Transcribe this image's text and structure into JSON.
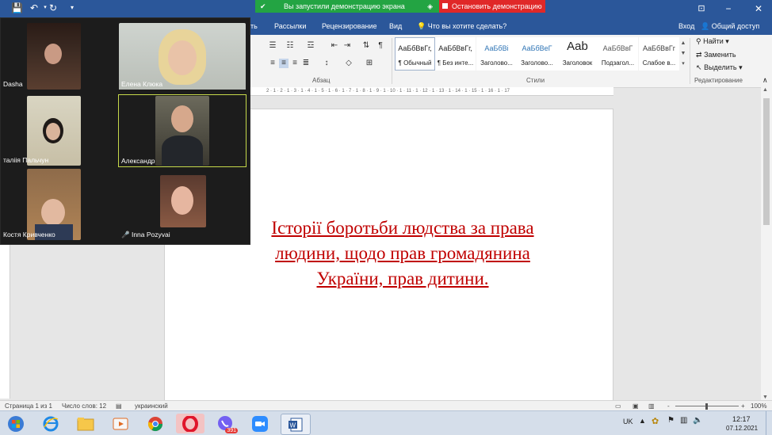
{
  "titlebar": {
    "share_status": "Вы запустили демонстрацию экрана",
    "stop_share": "Остановить демонстрацию",
    "signin": "Вход",
    "share": "Общий доступ"
  },
  "tabs": [
    "Рассылки",
    "Рецензирование",
    "Вид"
  ],
  "tab_partial": "ть",
  "tell_me": "Что вы хотите сделать?",
  "ribbon": {
    "styles": [
      {
        "sample": "АаБбВвГг,",
        "name": "¶ Обычный",
        "color": "#222222"
      },
      {
        "sample": "АаБбВвГг,",
        "name": "¶ Без инте...",
        "color": "#222222"
      },
      {
        "sample": "АаБбВі",
        "name": "Заголово...",
        "color": "#2e74b5"
      },
      {
        "sample": "АаБбВеГ",
        "name": "Заголово...",
        "color": "#2e74b5"
      },
      {
        "sample": "Aab",
        "name": "Заголовок",
        "color": "#222222"
      },
      {
        "sample": "АаБбВвГ",
        "name": "Подзагол...",
        "color": "#595959"
      },
      {
        "sample": "АаБбВвГг",
        "name": "Слабое в...",
        "color": "#404040"
      }
    ],
    "paragraph_label": "Абзац",
    "styles_label": "Стили",
    "edit_label": "Редактирование",
    "find": "Найти",
    "replace": "Заменить",
    "select": "Выделить"
  },
  "ruler_marks": "2 · 1 · 2 · 1 · 3 · 1 · 4 · 1 · 5 · 1 · 6 · 1 · 7 · 1 · 8 · 1 · 9 · 1 · 10 · 1 · 11 · 1 · 12 · 1 · 13 · 1 · 14 · 1 · 15 · 1 · 16 · 1 · 17",
  "document": {
    "lines": [
      "Історії боротьби людства за права",
      "людини, щодо прав громадянина",
      "України, прав дитини."
    ]
  },
  "status": {
    "page": "Страница 1 из 1",
    "words": "Число слов: 12",
    "language": "украинский",
    "zoom": "100%",
    "zoom_minus": "-",
    "zoom_plus": "+"
  },
  "taskbar": {
    "lang": "UK",
    "time": "12:17",
    "date": "07.12.2021",
    "viber_badge": "391"
  },
  "participants": [
    {
      "name": "Dasha",
      "muted": false
    },
    {
      "name": "Елена Клюка",
      "muted": false
    },
    {
      "name": "таліія Пальчун",
      "muted": false
    },
    {
      "name": "Александр",
      "muted": false,
      "active": true
    },
    {
      "name": "Костя Кривченко",
      "muted": false
    },
    {
      "name": "Inna Pozyvai",
      "muted": true
    }
  ],
  "colors": {
    "word_blue": "#2b579a",
    "doc_text": "#c00000",
    "share_green": "#23a443",
    "stop_red": "#e02828"
  }
}
